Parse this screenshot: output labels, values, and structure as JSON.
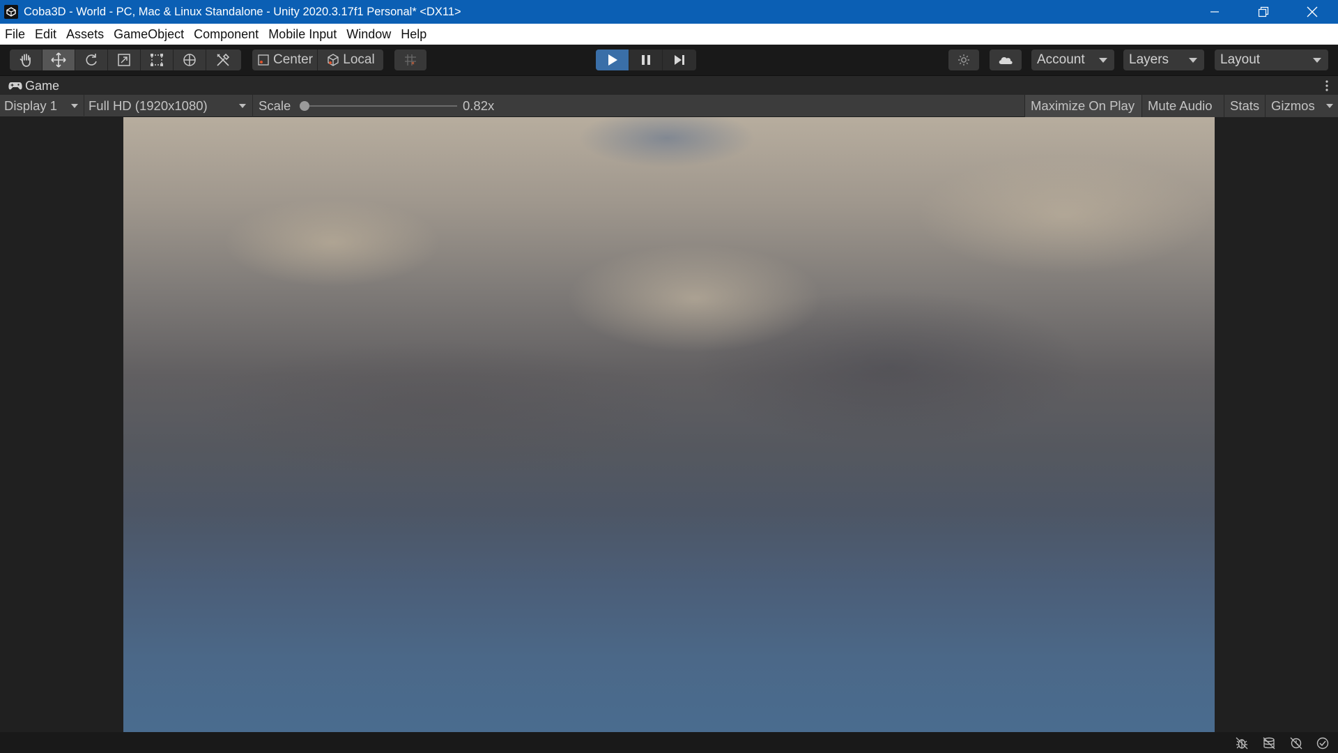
{
  "window": {
    "title": "Coba3D - World - PC, Mac & Linux Standalone - Unity 2020.3.17f1 Personal* <DX11>"
  },
  "menu": [
    "File",
    "Edit",
    "Assets",
    "GameObject",
    "Component",
    "Mobile Input",
    "Window",
    "Help"
  ],
  "toolbar": {
    "pivot_mode": "Center",
    "pivot_rotation": "Local",
    "account_label": "Account",
    "layers_label": "Layers",
    "layout_label": "Layout"
  },
  "tab": {
    "label": "Game"
  },
  "game_bar": {
    "display": "Display 1",
    "resolution": "Full HD (1920x1080)",
    "scale_label": "Scale",
    "scale_value": "0.82x",
    "maximize_on_play": "Maximize On Play",
    "mute_audio": "Mute Audio",
    "stats": "Stats",
    "gizmos": "Gizmos"
  },
  "colors": {
    "title_bar": "#0b5fb4",
    "editor_bg": "#191919",
    "play_active": "#3a6fa8"
  }
}
